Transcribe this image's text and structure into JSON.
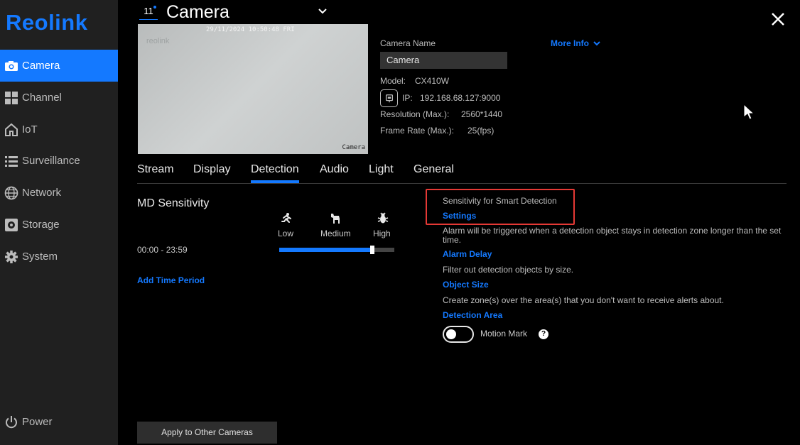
{
  "sidebar": {
    "logo": "Reolink",
    "items": [
      {
        "label": "Camera",
        "icon": "camera-icon"
      },
      {
        "label": "Channel",
        "icon": "grid-icon"
      },
      {
        "label": "IoT",
        "icon": "home-icon"
      },
      {
        "label": "Surveillance",
        "icon": "list-icon"
      },
      {
        "label": "Network",
        "icon": "globe-icon"
      },
      {
        "label": "Storage",
        "icon": "storage-icon"
      },
      {
        "label": "System",
        "icon": "gear-icon"
      }
    ],
    "power_label": "Power"
  },
  "header": {
    "channel_number": "11",
    "title": "Camera"
  },
  "preview": {
    "timestamp": "29/11/2024 10:50:48 FRI",
    "overlay_text": "reolink",
    "camera_label": "Camera"
  },
  "info": {
    "camera_name_label": "Camera Name",
    "camera_name_value": "Camera",
    "more_info": "More Info",
    "model_label": "Model:",
    "model_value": "CX410W",
    "ip_label": "IP:",
    "ip_value": "192.168.68.127:9000",
    "resolution_label": "Resolution (Max.):",
    "resolution_value": "2560*1440",
    "framerate_label": "Frame Rate (Max.):",
    "framerate_value": "25(fps)"
  },
  "tabs": [
    "Stream",
    "Display",
    "Detection",
    "Audio",
    "Light",
    "General"
  ],
  "active_tab": "Detection",
  "detection": {
    "title": "MD Sensitivity",
    "time_range": "00:00 - 23:59",
    "add_time": "Add Time Period",
    "levels": [
      "Low",
      "Medium",
      "High"
    ],
    "sensitivity_percent": 81
  },
  "settings": {
    "smart_detection_label": "Sensitivity for Smart Detection",
    "smart_detection_link": "Settings",
    "alarm_delay_desc": "Alarm will be triggered when a detection object stays in detection zone longer than the set time.",
    "alarm_delay_link": "Alarm Delay",
    "object_size_desc": "Filter out detection objects by size.",
    "object_size_link": "Object Size",
    "detection_area_desc": "Create zone(s) over the area(s) that you don't want to receive alerts about.",
    "detection_area_link": "Detection Area",
    "motion_mark_label": "Motion Mark",
    "motion_mark_on": false,
    "help": "?"
  },
  "footer": {
    "apply_button": "Apply to Other Cameras"
  },
  "colors": {
    "accent": "#1479ff",
    "sidebar_bg": "#202020",
    "highlight": "#e53935"
  }
}
